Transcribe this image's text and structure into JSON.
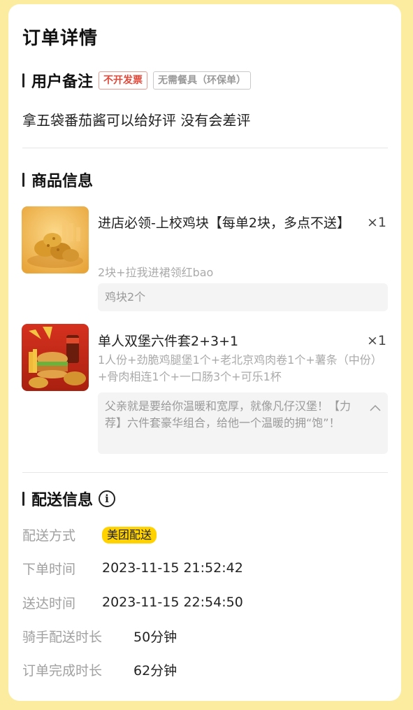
{
  "page": {
    "title": "订单详情"
  },
  "remark": {
    "section_title": "用户备注",
    "tags": [
      "不开发票",
      "无需餐具（环保单）"
    ],
    "text": "拿五袋番茄酱可以给好评 没有会差评"
  },
  "products": {
    "section_title": "商品信息",
    "items": [
      {
        "name": "进店必领-上校鸡块【每单2块，多点不送】",
        "qty": "×1",
        "spec": "2块+拉我进裙领红bao",
        "note": "鸡块2个",
        "image": "chicken-nuggets-image"
      },
      {
        "name": "单人双堡六件套2+3+1",
        "qty": "×1",
        "spec": "1人份+劲脆鸡腿堡1个+老北京鸡肉卷1个+薯条（中份）+骨肉相连1个+一口肠3个+可乐1杯",
        "note": "父亲就是要给你温暖和宽厚，就像凡仔汉堡！【力荐】六件套豪华组合，给他一个温暖的拥“饱”！",
        "image": "burger-combo-image"
      }
    ]
  },
  "delivery": {
    "section_title": "配送信息",
    "info_icon": "info-icon",
    "rows": [
      {
        "label": "配送方式",
        "value": "美团配送"
      },
      {
        "label": "下单时间",
        "value": "2023-11-15 21:52:42"
      },
      {
        "label": "送达时间",
        "value": "2023-11-15 22:54:50"
      },
      {
        "label": "骑手配送时长",
        "value": "50分钟"
      },
      {
        "label": "订单完成时长",
        "value": "62分钟"
      }
    ]
  },
  "colors": {
    "background": "#fbeca0",
    "badge": "#ffd200",
    "tag_red": "#e0493a"
  }
}
